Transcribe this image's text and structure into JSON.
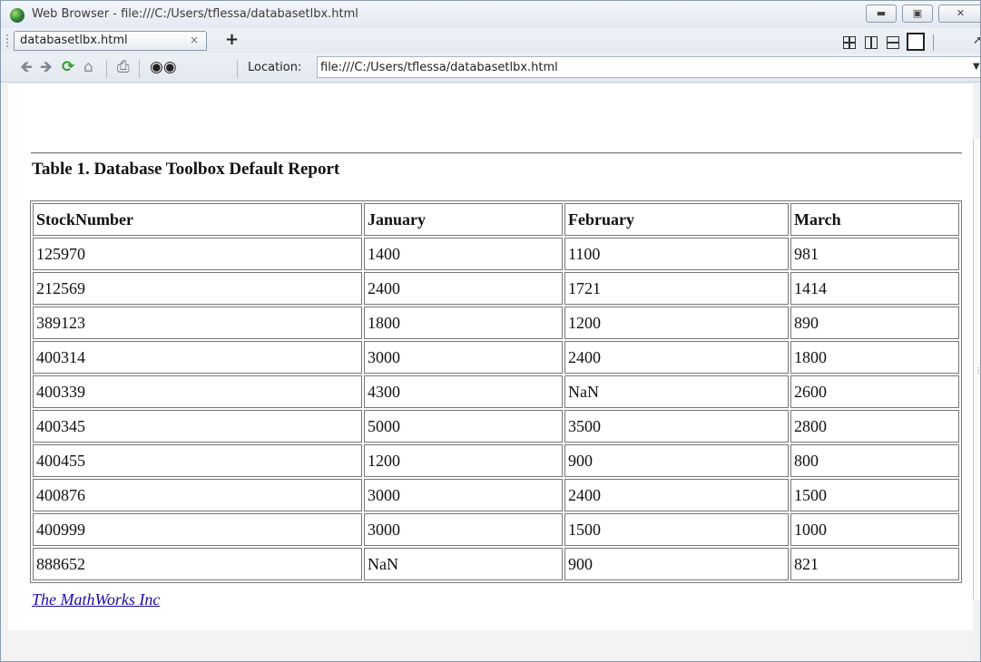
{
  "window": {
    "title": "Web Browser - file:///C:/Users/tflessa/databasetlbx.html"
  },
  "tabs": {
    "active_label": "databasetlbx.html",
    "close_glyph": "×",
    "new_tab_glyph": "+"
  },
  "toolbar": {
    "location_label": "Location:",
    "location_value": "file:///C:/Users/tflessa/databasetlbx.html"
  },
  "page": {
    "caption": "Table 1. Database Toolbox Default Report",
    "headers": [
      "StockNumber",
      "January",
      "February",
      "March"
    ],
    "rows": [
      [
        "125970",
        "1400",
        "1100",
        "981"
      ],
      [
        "212569",
        "2400",
        "1721",
        "1414"
      ],
      [
        "389123",
        "1800",
        "1200",
        "890"
      ],
      [
        "400314",
        "3000",
        "2400",
        "1800"
      ],
      [
        "400339",
        "4300",
        "NaN",
        "2600"
      ],
      [
        "400345",
        "5000",
        "3500",
        "2800"
      ],
      [
        "400455",
        "1200",
        "900",
        "800"
      ],
      [
        "400876",
        "3000",
        "2400",
        "1500"
      ],
      [
        "400999",
        "3000",
        "1500",
        "1000"
      ],
      [
        "888652",
        "NaN",
        "900",
        "821"
      ]
    ],
    "footer_link": "The MathWorks Inc"
  },
  "colors": {
    "link": "#1a0dab",
    "refresh_green": "#2e9a2e"
  }
}
